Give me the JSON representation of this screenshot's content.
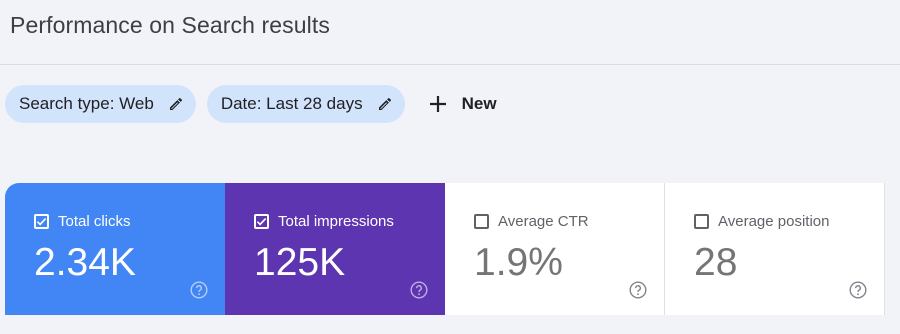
{
  "page": {
    "title": "Performance on Search results"
  },
  "filters": [
    {
      "label": "Search type: Web",
      "icon": "pencil-icon"
    },
    {
      "label": "Date: Last 28 days",
      "icon": "pencil-icon"
    }
  ],
  "new_button": {
    "label": "New",
    "icon": "plus-icon"
  },
  "metrics": [
    {
      "label": "Total clicks",
      "value": "2.34K",
      "checked": true,
      "color": "#4285f4"
    },
    {
      "label": "Total impressions",
      "value": "125K",
      "checked": true,
      "color": "#5e35b1"
    },
    {
      "label": "Average CTR",
      "value": "1.9%",
      "checked": false,
      "color": "#ffffff"
    },
    {
      "label": "Average position",
      "value": "28",
      "checked": false,
      "color": "#ffffff"
    }
  ],
  "help_icon": "help-circle-icon",
  "colors": {
    "background": "#f1f3f8",
    "chip": "#d2e3fc"
  }
}
